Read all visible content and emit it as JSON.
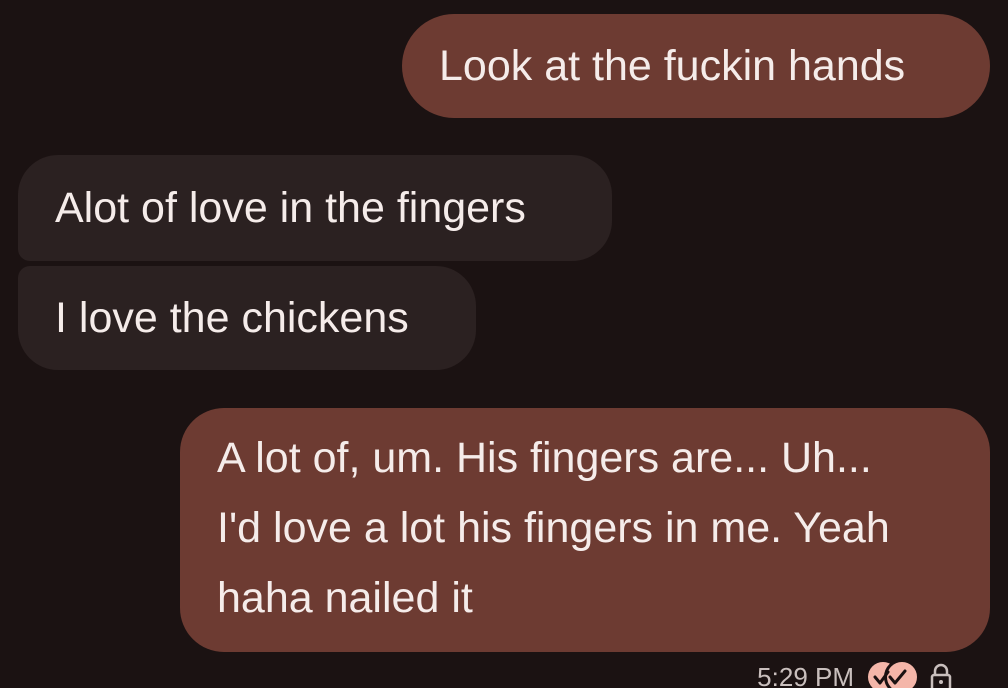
{
  "messages": [
    {
      "direction": "outgoing",
      "text": "Look at the fuckin hands"
    },
    {
      "direction": "incoming",
      "text": "Alot of love in the fingers"
    },
    {
      "direction": "incoming",
      "text": "I love the chickens"
    },
    {
      "direction": "outgoing",
      "lines": [
        "A lot of, um. His fingers are... Uh...",
        "I'd love a lot his fingers in me. Yeah",
        "haha nailed it"
      ]
    }
  ],
  "footer": {
    "timestamp": "5:29 PM",
    "status_icon": "double-check-icon",
    "security_icon": "lock-icon"
  },
  "colors": {
    "background": "#1b1212",
    "outgoing_bubble": "#6d3b32",
    "incoming_bubble": "#2b2121",
    "text": "#f5ecea",
    "accent": "#f4b6a9"
  }
}
